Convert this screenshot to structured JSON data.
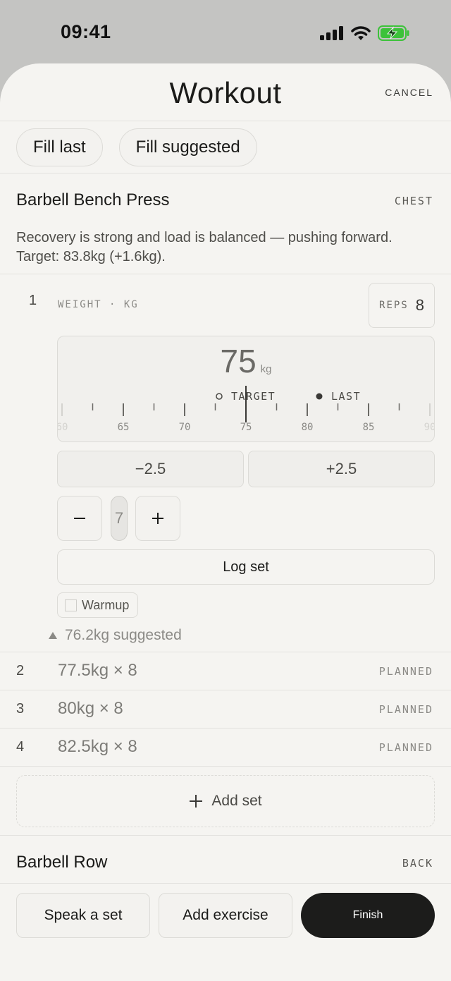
{
  "status_bar": {
    "time": "09:41"
  },
  "header": {
    "title": "Workout",
    "cancel_label": "CANCEL"
  },
  "fill_actions": {
    "fill_last": "Fill last",
    "fill_suggested": "Fill suggested"
  },
  "exercise": {
    "name": "Barbell Bench Press",
    "muscle": "CHEST",
    "advice": "Recovery is strong and load is balanced — pushing forward. Target: 83.8kg (+1.6kg).",
    "active_set": {
      "index": "1",
      "weight_label": "WEIGHT · KG",
      "reps_label": "REPS",
      "reps_value": "8",
      "weight_value": "75",
      "weight_unit": "kg",
      "legend": {
        "target": "TARGET",
        "last": "LAST"
      },
      "scale": {
        "min": 60,
        "max": 90,
        "labels": [
          "60",
          "65",
          "70",
          "75",
          "80",
          "85",
          "90"
        ],
        "current": 75,
        "target": 73,
        "last": 80
      },
      "decrement_label": "−2.5",
      "increment_label": "+2.5",
      "reps_stepper_value": "7",
      "log_label": "Log set",
      "warmup_label": "Warmup",
      "suggested_text": "76.2kg suggested"
    },
    "planned_sets": [
      {
        "index": "2",
        "value": "77.5kg × 8",
        "status": "PLANNED"
      },
      {
        "index": "3",
        "value": "80kg × 8",
        "status": "PLANNED"
      },
      {
        "index": "4",
        "value": "82.5kg × 8",
        "status": "PLANNED"
      }
    ],
    "add_set_label": "Add set"
  },
  "next_exercise": {
    "name": "Barbell Row",
    "muscle": "BACK"
  },
  "bottom_bar": {
    "speak_label": "Speak a set",
    "add_exercise_label": "Add exercise",
    "finish_label": "Finish"
  },
  "colors": {
    "accent_dark": "#1c1c1b",
    "battery_green": "#3cc23a",
    "background": "#f5f4f1"
  },
  "icons": [
    "signal-icon",
    "wifi-icon",
    "battery-charging-icon",
    "minus-icon",
    "plus-icon",
    "triangle-up-icon"
  ]
}
